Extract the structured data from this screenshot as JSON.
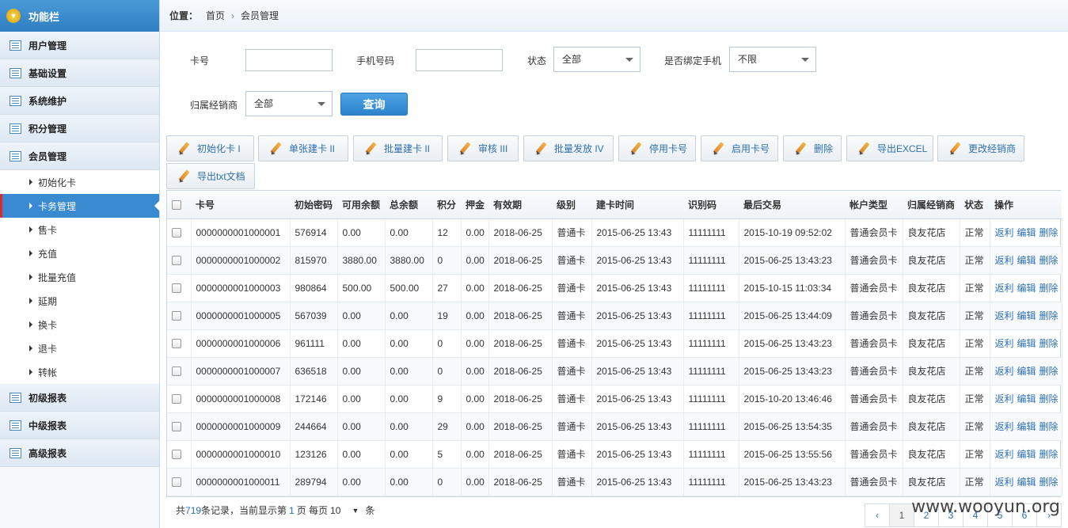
{
  "sidebar": {
    "title": "功能栏",
    "groups_top": [
      "用户管理",
      "基础设置",
      "系统维护",
      "积分管理",
      "会员管理"
    ],
    "sub_items": [
      "初始化卡",
      "卡务管理",
      "售卡",
      "充值",
      "批量充值",
      "延期",
      "换卡",
      "退卡",
      "转帐"
    ],
    "active_sub": "卡务管理",
    "groups_bottom": [
      "初级报表",
      "中级报表",
      "高级报表"
    ]
  },
  "breadcrumb": {
    "label": "位置：",
    "home": "首页",
    "sep": "›",
    "current": "会员管理"
  },
  "filters": {
    "card_label": "卡号",
    "phone_label": "手机号码",
    "status_label": "状态",
    "status_value": "全部",
    "bind_label": "是否绑定手机",
    "bind_value": "不限",
    "dealer_label": "归属经销商",
    "dealer_value": "全部",
    "query_button": "查询"
  },
  "toolbar": [
    "初始化卡 I",
    "单张建卡 II",
    "批量建卡 II",
    "审核 III",
    "批量发放 IV",
    "停用卡号",
    "启用卡号",
    "删除",
    "导出EXCEL",
    "更改经销商",
    "导出txt文档"
  ],
  "table": {
    "headers": [
      "卡号",
      "初始密码",
      "可用余额",
      "总余额",
      "积分",
      "押金",
      "有效期",
      "级别",
      "建卡时间",
      "识别码",
      "最后交易",
      "帐户类型",
      "归属经销商",
      "状态",
      "操作"
    ],
    "ops": [
      "返利",
      "编辑",
      "删除"
    ],
    "rows": [
      [
        "0000000001000001",
        "576914",
        "0.00",
        "0.00",
        "12",
        "0.00",
        "2018-06-25",
        "普通卡",
        "2015-06-25 13:43",
        "11111111",
        "2015-10-19 09:52:02",
        "普通会员卡",
        "良友花店",
        "正常"
      ],
      [
        "0000000001000002",
        "815970",
        "3880.00",
        "3880.00",
        "0",
        "0.00",
        "2018-06-25",
        "普通卡",
        "2015-06-25 13:43",
        "11111111",
        "2015-06-25 13:43:23",
        "普通会员卡",
        "良友花店",
        "正常"
      ],
      [
        "0000000001000003",
        "980864",
        "500.00",
        "500.00",
        "27",
        "0.00",
        "2018-06-25",
        "普通卡",
        "2015-06-25 13:43",
        "11111111",
        "2015-10-15 11:03:34",
        "普通会员卡",
        "良友花店",
        "正常"
      ],
      [
        "0000000001000005",
        "567039",
        "0.00",
        "0.00",
        "19",
        "0.00",
        "2018-06-25",
        "普通卡",
        "2015-06-25 13:43",
        "11111111",
        "2015-06-25 13:44:09",
        "普通会员卡",
        "良友花店",
        "正常"
      ],
      [
        "0000000001000006",
        "961111",
        "0.00",
        "0.00",
        "0",
        "0.00",
        "2018-06-25",
        "普通卡",
        "2015-06-25 13:43",
        "11111111",
        "2015-06-25 13:43:23",
        "普通会员卡",
        "良友花店",
        "正常"
      ],
      [
        "0000000001000007",
        "636518",
        "0.00",
        "0.00",
        "0",
        "0.00",
        "2018-06-25",
        "普通卡",
        "2015-06-25 13:43",
        "11111111",
        "2015-06-25 13:43:23",
        "普通会员卡",
        "良友花店",
        "正常"
      ],
      [
        "0000000001000008",
        "172146",
        "0.00",
        "0.00",
        "9",
        "0.00",
        "2018-06-25",
        "普通卡",
        "2015-06-25 13:43",
        "11111111",
        "2015-10-20 13:46:46",
        "普通会员卡",
        "良友花店",
        "正常"
      ],
      [
        "0000000001000009",
        "244664",
        "0.00",
        "0.00",
        "29",
        "0.00",
        "2018-06-25",
        "普通卡",
        "2015-06-25 13:43",
        "11111111",
        "2015-06-25 13:54:35",
        "普通会员卡",
        "良友花店",
        "正常"
      ],
      [
        "0000000001000010",
        "123126",
        "0.00",
        "0.00",
        "5",
        "0.00",
        "2018-06-25",
        "普通卡",
        "2015-06-25 13:43",
        "11111111",
        "2015-06-25 13:55:56",
        "普通会员卡",
        "良友花店",
        "正常"
      ],
      [
        "0000000001000011",
        "289794",
        "0.00",
        "0.00",
        "0",
        "0.00",
        "2018-06-25",
        "普通卡",
        "2015-06-25 13:43",
        "11111111",
        "2015-06-25 13:43:23",
        "普通会员卡",
        "良友花店",
        "正常"
      ]
    ]
  },
  "pager": {
    "prefix": "共",
    "total": "719",
    "mid": "条记录，当前显示第",
    "page": "1",
    "mid2": "页 每页",
    "per_page": "10",
    "arrow": "▼",
    "suffix": "条",
    "pages": [
      "‹",
      "1",
      "2",
      "3",
      "4",
      "5",
      "6",
      "›"
    ],
    "current_page": "1"
  },
  "watermark": "www.wooyun.org",
  "colors": {
    "accent": "#3a8ad1",
    "link": "#2a6fb8",
    "active_marker": "#e02a2a"
  }
}
